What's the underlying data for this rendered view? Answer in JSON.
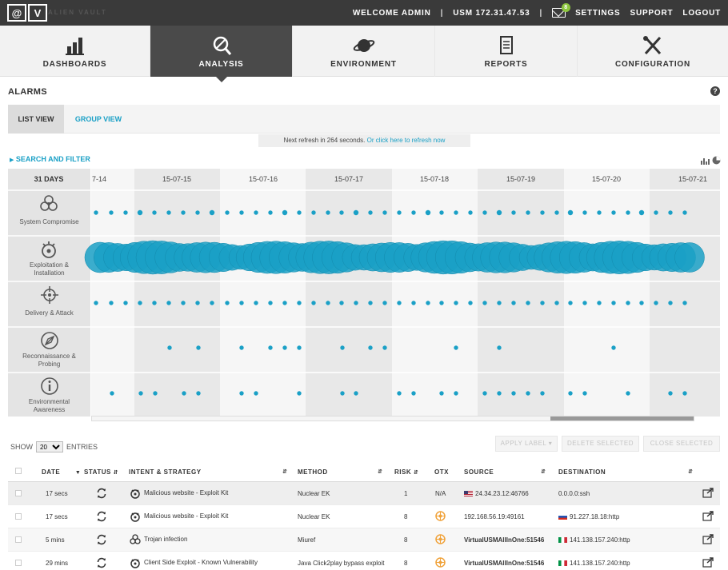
{
  "topbar": {
    "logo_letters": [
      "@",
      "V"
    ],
    "logo_text": "ALIEN VAULT",
    "welcome": "WELCOME ADMIN",
    "usm": "USM 172.31.47.53",
    "mail_count": "8",
    "settings": "SETTINGS",
    "support": "SUPPORT",
    "logout": "LOGOUT"
  },
  "nav": {
    "items": [
      {
        "label": "DASHBOARDS",
        "icon": "bar-chart-icon"
      },
      {
        "label": "ANALYSIS",
        "icon": "magnifier-icon"
      },
      {
        "label": "ENVIRONMENT",
        "icon": "planet-icon"
      },
      {
        "label": "REPORTS",
        "icon": "document-icon"
      },
      {
        "label": "CONFIGURATION",
        "icon": "tools-icon"
      }
    ],
    "active": "ANALYSIS"
  },
  "page": {
    "title": "ALARMS",
    "help": "?",
    "tabs": {
      "list": "LIST VIEW",
      "group": "GROUP VIEW"
    },
    "refresh_text": "Next refresh in 264 seconds.",
    "refresh_link": "Or click here to refresh now",
    "search_filter": "SEARCH AND FILTER"
  },
  "timeline": {
    "range_label": "31 DAYS",
    "dates": [
      "7-14",
      "15-07-15",
      "15-07-16",
      "15-07-17",
      "15-07-18",
      "15-07-19",
      "15-07-20",
      "15-07-21"
    ],
    "rows": [
      {
        "label": "System Compromise",
        "icon": "biohazard-icon"
      },
      {
        "label": "Exploitation & Installation",
        "icon": "bomb-icon"
      },
      {
        "label": "Delivery & Attack",
        "icon": "crosshair-icon"
      },
      {
        "label": "Reconnaissance & Probing",
        "icon": "compass-icon"
      },
      {
        "label": "Environmental Awareness",
        "icon": "info-icon"
      }
    ],
    "dot_color": "#1aa0c6"
  },
  "table_controls": {
    "show_label": "SHOW",
    "show_value": "20",
    "entries_label": "ENTRIES",
    "apply_label": "APPLY LABEL",
    "delete_selected": "DELETE SELECTED",
    "close_selected": "CLOSE SELECTED"
  },
  "table": {
    "headers": {
      "date": "DATE",
      "status": "STATUS",
      "intent": "INTENT & STRATEGY",
      "method": "METHOD",
      "risk": "RISK",
      "otx": "OTX",
      "source": "SOURCE",
      "destination": "DESTINATION"
    },
    "rows": [
      {
        "date": "17 secs",
        "intent": "Malicious website - Exploit Kit",
        "intent_icon": "bomb-icon",
        "method": "Nuclear EK",
        "risk": "1",
        "otx": "N/A",
        "source": "24.34.23.12:46766",
        "source_flag": "us",
        "destination": "0.0.0.0:ssh",
        "dest_flag": ""
      },
      {
        "date": "17 secs",
        "intent": "Malicious website - Exploit Kit",
        "intent_icon": "bomb-icon",
        "method": "Nuclear EK",
        "risk": "8",
        "otx": "otx-icon",
        "source": "192.168.56.19:49161",
        "source_flag": "",
        "destination": "91.227.18.18:http",
        "dest_flag": "ru"
      },
      {
        "date": "5 mins",
        "intent": "Trojan infection",
        "intent_icon": "biohazard-icon",
        "method": "Miuref",
        "risk": "8",
        "otx": "otx-icon",
        "source": "VirtualUSMAllInOne:51546",
        "source_flag": "",
        "destination": "141.138.157.240:http",
        "dest_flag": "it"
      },
      {
        "date": "29 mins",
        "intent": "Client Side Exploit - Known Vulnerability",
        "intent_icon": "bomb-icon",
        "method": "Java Click2play bypass exploit",
        "risk": "8",
        "otx": "otx-icon",
        "source": "VirtualUSMAllInOne:51546",
        "source_flag": "",
        "destination": "141.138.157.240:http",
        "dest_flag": "it"
      }
    ]
  }
}
